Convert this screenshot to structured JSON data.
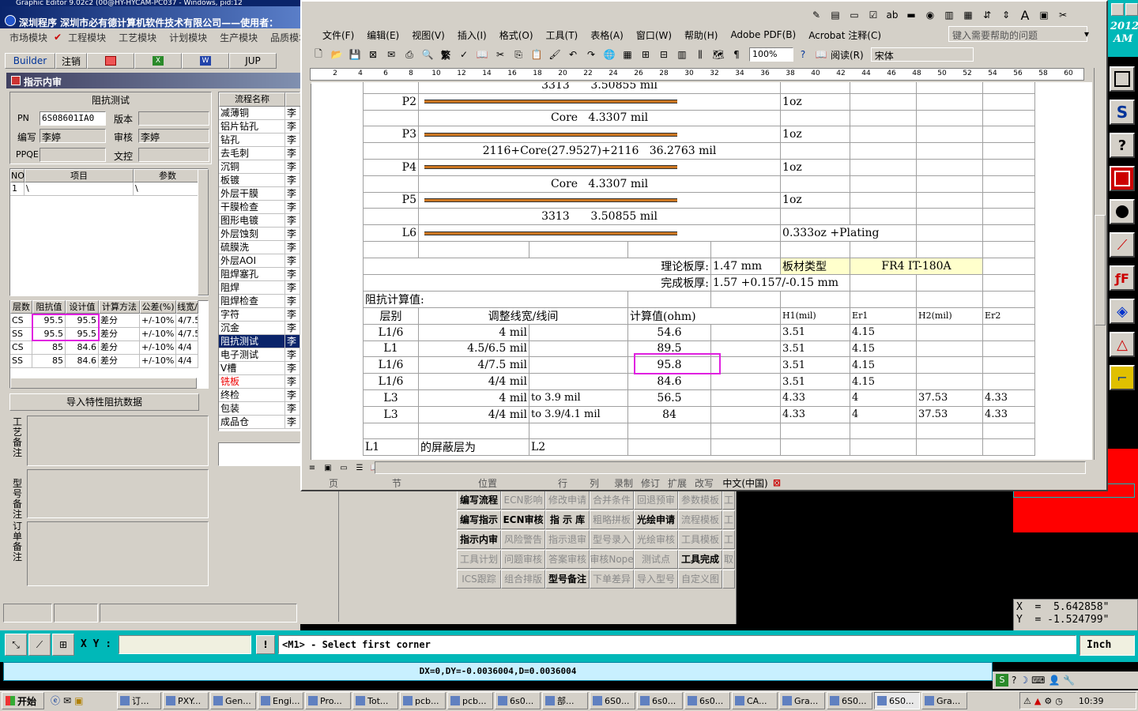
{
  "erp": {
    "window_title": "深圳程序   深圳市必有德计算机软件技术有限公司——使用者：",
    "ge_title": "Graphic Editor 9.02c2 (00@HY-HYCAM-PC037 - Windows, pid:12",
    "menu": [
      "市场模块",
      "工程模块",
      "工艺模块",
      "计划模块",
      "生产模块",
      "品质模块"
    ],
    "toolbar": [
      "Builder",
      "注销",
      "",
      "",
      "",
      "JUP"
    ],
    "panel_title": "指示内审",
    "form_title": "阻抗测试",
    "pn_label": "PN",
    "pn_value": "6S08601IA0",
    "version_label": "版本",
    "version_value": "",
    "writer_label": "编写",
    "writer_value": "李婷",
    "reviewer_label": "审核",
    "reviewer_value": "李婷",
    "ppqe_label": "PPQE",
    "ppqe_value": "",
    "control_label": "文控",
    "control_value": "",
    "items_headers": [
      "NO",
      "项目",
      "参数"
    ],
    "items_rows": [
      [
        "1",
        "\\",
        "\\"
      ]
    ],
    "imp_headers": [
      "层数",
      "阻抗值",
      "设计值",
      "计算方法",
      "公差(%)",
      "线宽/"
    ],
    "imp_rows": [
      [
        "CS",
        "95.5",
        "95.5",
        "差分",
        "+/-10%",
        "4/7.5"
      ],
      [
        "SS",
        "95.5",
        "95.5",
        "差分",
        "+/-10%",
        "4/7.5"
      ],
      [
        "CS",
        "85",
        "84.6",
        "差分",
        "+/-10%",
        "4/4"
      ],
      [
        "SS",
        "85",
        "84.6",
        "差分",
        "+/-10%",
        "4/4"
      ]
    ],
    "import_button": "导入特性阻抗数据",
    "note1": "工艺备注",
    "note2": "型号备注",
    "note3": "订单备注",
    "flow_header": [
      "流程名称",
      ""
    ],
    "flow_rows": [
      [
        "减薄铜",
        "李"
      ],
      [
        "铝片钻孔",
        "李"
      ],
      [
        "钻孔",
        "李"
      ],
      [
        "去毛刺",
        "李"
      ],
      [
        "沉铜",
        "李"
      ],
      [
        "板镀",
        "李"
      ],
      [
        "外层干膜",
        "李"
      ],
      [
        "干膜检查",
        "李"
      ],
      [
        "图形电镀",
        "李"
      ],
      [
        "外层蚀刻",
        "李"
      ],
      [
        "硫膜洗",
        "李"
      ],
      [
        "外层AOI",
        "李"
      ],
      [
        "阻焊塞孔",
        "李"
      ],
      [
        "阻焊",
        "李"
      ],
      [
        "阻焊检查",
        "李"
      ],
      [
        "字符",
        "李"
      ],
      [
        "沉金",
        "李"
      ],
      [
        "阻抗测试",
        "李"
      ],
      [
        "电子测试",
        "李"
      ],
      [
        "V槽",
        "李"
      ],
      [
        "铣板",
        "李"
      ],
      [
        "终检",
        "李"
      ],
      [
        "包装",
        "李"
      ],
      [
        "成品仓",
        "李"
      ]
    ]
  },
  "word": {
    "menu": [
      "文件(F)",
      "编辑(E)",
      "视图(V)",
      "插入(I)",
      "格式(O)",
      "工具(T)",
      "表格(A)",
      "窗口(W)",
      "帮助(H)",
      "Adobe PDF(B)",
      "Acrobat 注释(C)"
    ],
    "help_placeholder": "键入需要帮助的问题",
    "zoom": "100%",
    "read_label": "阅读(R)",
    "font_name": "宋体",
    "ruler": [
      "2",
      "4",
      "6",
      "8",
      "10",
      "12",
      "14",
      "16",
      "18",
      "20",
      "22",
      "24",
      "26",
      "28",
      "30",
      "32",
      "34",
      "36",
      "38",
      "40",
      "42",
      "44",
      "46",
      "48",
      "50",
      "52",
      "54",
      "56",
      "58",
      "60"
    ],
    "status": [
      "页",
      "节",
      "位置",
      "行",
      "列",
      "录制",
      "修订",
      "扩展",
      "改写",
      "中文(中国)"
    ],
    "doc": {
      "r0": [
        "3313",
        "3.50855 mil"
      ],
      "p2": "P2",
      "oz1": "1oz",
      "core1": [
        "Core",
        "4.3307 mil"
      ],
      "p3": "P3",
      "oz2": "1oz",
      "pp2116": [
        "2116+Core(27.9527)+2116",
        "36.2763 mil"
      ],
      "p4": "P4",
      "oz3": "1oz",
      "core2": [
        "Core",
        "4.3307 mil"
      ],
      "p5": "P5",
      "oz4": "1oz",
      "r3313b": [
        "3313",
        "3.50855 mil"
      ],
      "l6": "L6",
      "l6oz": "0.333oz +Plating",
      "theory_label": "理论板厚:",
      "theory_value": "1.47 mm",
      "material_label": "板材类型",
      "material_value": "FR4 IT-180A",
      "finish_label": "完成板厚:",
      "finish_value": "1.57 +0.157/-0.15 mm",
      "imp_title": "阻抗计算值:",
      "headers": [
        "层别",
        "调整线宽/线间",
        "计算值(ohm)",
        "H1(mil)",
        "Er1",
        "H2(mil)",
        "Er2"
      ],
      "rows": [
        [
          "L1/6",
          "4 mil",
          "",
          "54.6",
          "",
          "3.51",
          "4.15",
          "",
          ""
        ],
        [
          "L1",
          "4.5/6.5 mil",
          "",
          "89.5",
          "",
          "3.51",
          "4.15",
          "",
          ""
        ],
        [
          "L1/6",
          "4/7.5 mil",
          "",
          "95.8",
          "",
          "3.51",
          "4.15",
          "",
          ""
        ],
        [
          "L1/6",
          "4/4 mil",
          "",
          "84.6",
          "",
          "3.51",
          "4.15",
          "",
          ""
        ],
        [
          "L3",
          "4 mil",
          "to 3.9 mil",
          "56.5",
          "",
          "4.33",
          "4",
          "37.53",
          "4.33"
        ],
        [
          "L3",
          "4/4 mil",
          "to 3.9/4.1 mil",
          "84",
          "",
          "4.33",
          "4",
          "37.53",
          "4.33"
        ]
      ],
      "partial": [
        "L1",
        "的屏蔽层为",
        "L2"
      ]
    }
  },
  "buttons_grid": [
    [
      "编写流程",
      "ECN影响",
      "修改申请",
      "合并条件",
      "回退预审",
      "参数模板",
      "工"
    ],
    [
      "编写指示",
      "ECN审核",
      "指 示 库",
      "粗略拼板",
      "光绘申请",
      "流程模板",
      "工"
    ],
    [
      "指示内审",
      "风险警告",
      "指示退审",
      "型号录入",
      "光绘审核",
      "工具模板",
      "工"
    ],
    [
      "工具计划",
      "问题审核",
      "答案审核",
      "审核Nope",
      "测试点",
      "工具完成",
      "取"
    ],
    [
      "ICS跟踪",
      "组合排版",
      "型号备注",
      "下单差异",
      "导入型号",
      "自定义图",
      ""
    ]
  ],
  "buttons_enabled": [
    "编写流程",
    "编写指示",
    "ECN审核",
    "指 示 库",
    "光绘申请",
    "指示内审",
    "工具完成",
    "型号备注"
  ],
  "cad": {
    "xy_label": "X Y :",
    "prompt": "<M1> - Select first corner",
    "units": "Inch",
    "status": "DX=0,DY=-0.0036004,D=0.0036004",
    "x_readout": "X  =  5.642858\"",
    "y_readout": "Y  = -1.524799\"",
    "clock_top": "2012",
    "ampm": "AM"
  },
  "taskbar": {
    "start": "开始",
    "items": [
      "订...",
      "PXY...",
      "Gen...",
      "Engi...",
      "Pro...",
      "Tot...",
      "pcb...",
      "pcb...",
      "6s0...",
      "部...",
      "6S0...",
      "6s0...",
      "6s0...",
      "CA...",
      "Gra...",
      "6S0...",
      "6S0...",
      "Gra..."
    ],
    "time": "10:39"
  },
  "colors": {
    "highlight": "#e020e0",
    "cad_red": "#ff0000",
    "title_blue": "#0a246a",
    "bar": "#cc7722"
  }
}
